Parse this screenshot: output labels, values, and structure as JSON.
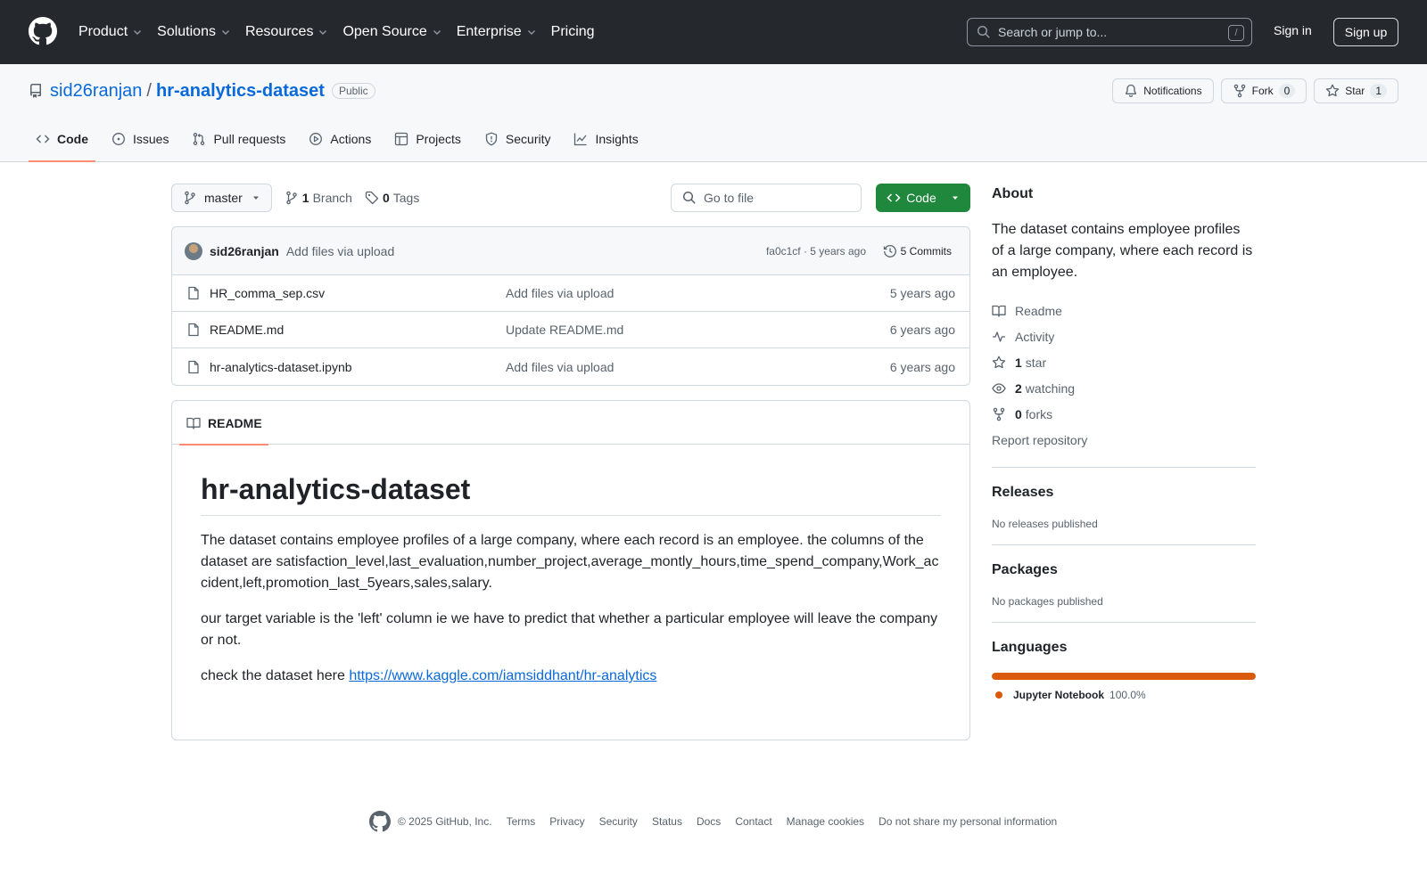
{
  "header": {
    "nav": [
      {
        "label": "Product",
        "has_menu": true
      },
      {
        "label": "Solutions",
        "has_menu": true
      },
      {
        "label": "Resources",
        "has_menu": true
      },
      {
        "label": "Open Source",
        "has_menu": true
      },
      {
        "label": "Enterprise",
        "has_menu": true
      },
      {
        "label": "Pricing",
        "has_menu": false
      }
    ],
    "search_placeholder": "Search or jump to...",
    "search_shortcut": "/",
    "sign_in": "Sign in",
    "sign_up": "Sign up"
  },
  "repo": {
    "owner": "sid26ranjan",
    "separator": "/",
    "name": "hr-analytics-dataset",
    "visibility": "Public",
    "actions": {
      "notifications": "Notifications",
      "fork_label": "Fork",
      "fork_count": "0",
      "star_label": "Star",
      "star_count": "1"
    },
    "tabs": [
      {
        "label": "Code",
        "icon": "code-icon",
        "active": true
      },
      {
        "label": "Issues",
        "icon": "issue-icon",
        "active": false
      },
      {
        "label": "Pull requests",
        "icon": "pull-request-icon",
        "active": false
      },
      {
        "label": "Actions",
        "icon": "play-icon",
        "active": false
      },
      {
        "label": "Projects",
        "icon": "table-icon",
        "active": false
      },
      {
        "label": "Security",
        "icon": "shield-icon",
        "active": false
      },
      {
        "label": "Insights",
        "icon": "graph-icon",
        "active": false
      }
    ]
  },
  "toolbar": {
    "branch": "master",
    "branch_count": "1",
    "branch_label": "Branch",
    "tag_count": "0",
    "tag_label": "Tags",
    "go_to_file": "Go to file",
    "code_button": "Code"
  },
  "latest_commit": {
    "author": "sid26ranjan",
    "message": "Add files via upload",
    "meta": "fa0c1cf · 5 years ago",
    "commits_label": "5 Commits"
  },
  "files": [
    {
      "name": "HR_comma_sep.csv",
      "commit": "Add files via upload",
      "date": "5 years ago"
    },
    {
      "name": "README.md",
      "commit": "Update README.md",
      "date": "6 years ago"
    },
    {
      "name": "hr-analytics-dataset.ipynb",
      "commit": "Add files via upload",
      "date": "6 years ago"
    }
  ],
  "readme": {
    "tab_label": "README",
    "title": "hr-analytics-dataset",
    "p1_text": "The dataset contains employee profiles of a large company, where each record is an employee. the columns of the dataset are",
    "p1_columns": "satisfaction_level,last_evaluation,number_project,average_montly_hours,time_spend_company,Work_accident,left,promotion_last_5years,sales,salary.",
    "p2": "our target variable is the 'left' column ie we have to predict that whether a particular employee will leave the company or not.",
    "p3_text": "check the dataset here ",
    "p3_link": "https://www.kaggle.com/iamsiddhant/hr-analytics"
  },
  "about": {
    "heading": "About",
    "description": "The dataset contains employee profiles of a large company, where each record is an employee.",
    "readme": "Readme",
    "activity": "Activity",
    "stars_count": "1",
    "stars_label": "star",
    "watching_count": "2",
    "watching_label": "watching",
    "forks_count": "0",
    "forks_label": "forks",
    "report": "Report repository"
  },
  "releases": {
    "heading": "Releases",
    "empty": "No releases published"
  },
  "packages": {
    "heading": "Packages",
    "empty": "No packages published"
  },
  "languages": {
    "heading": "Languages",
    "items": [
      {
        "name": "Jupyter Notebook",
        "percent": "100.0%",
        "fraction": 1.0,
        "color": "#DA5B0B"
      }
    ]
  },
  "footer": {
    "copyright": "© 2025 GitHub, Inc.",
    "links": [
      "Terms",
      "Privacy",
      "Security",
      "Status",
      "Docs",
      "Contact",
      "Manage cookies",
      "Do not share my personal information"
    ]
  },
  "colors": {
    "header_bg": "#25292e",
    "link": "#0969da",
    "primary_button": "#1f883d",
    "tab_underline": "#fd8c73"
  }
}
